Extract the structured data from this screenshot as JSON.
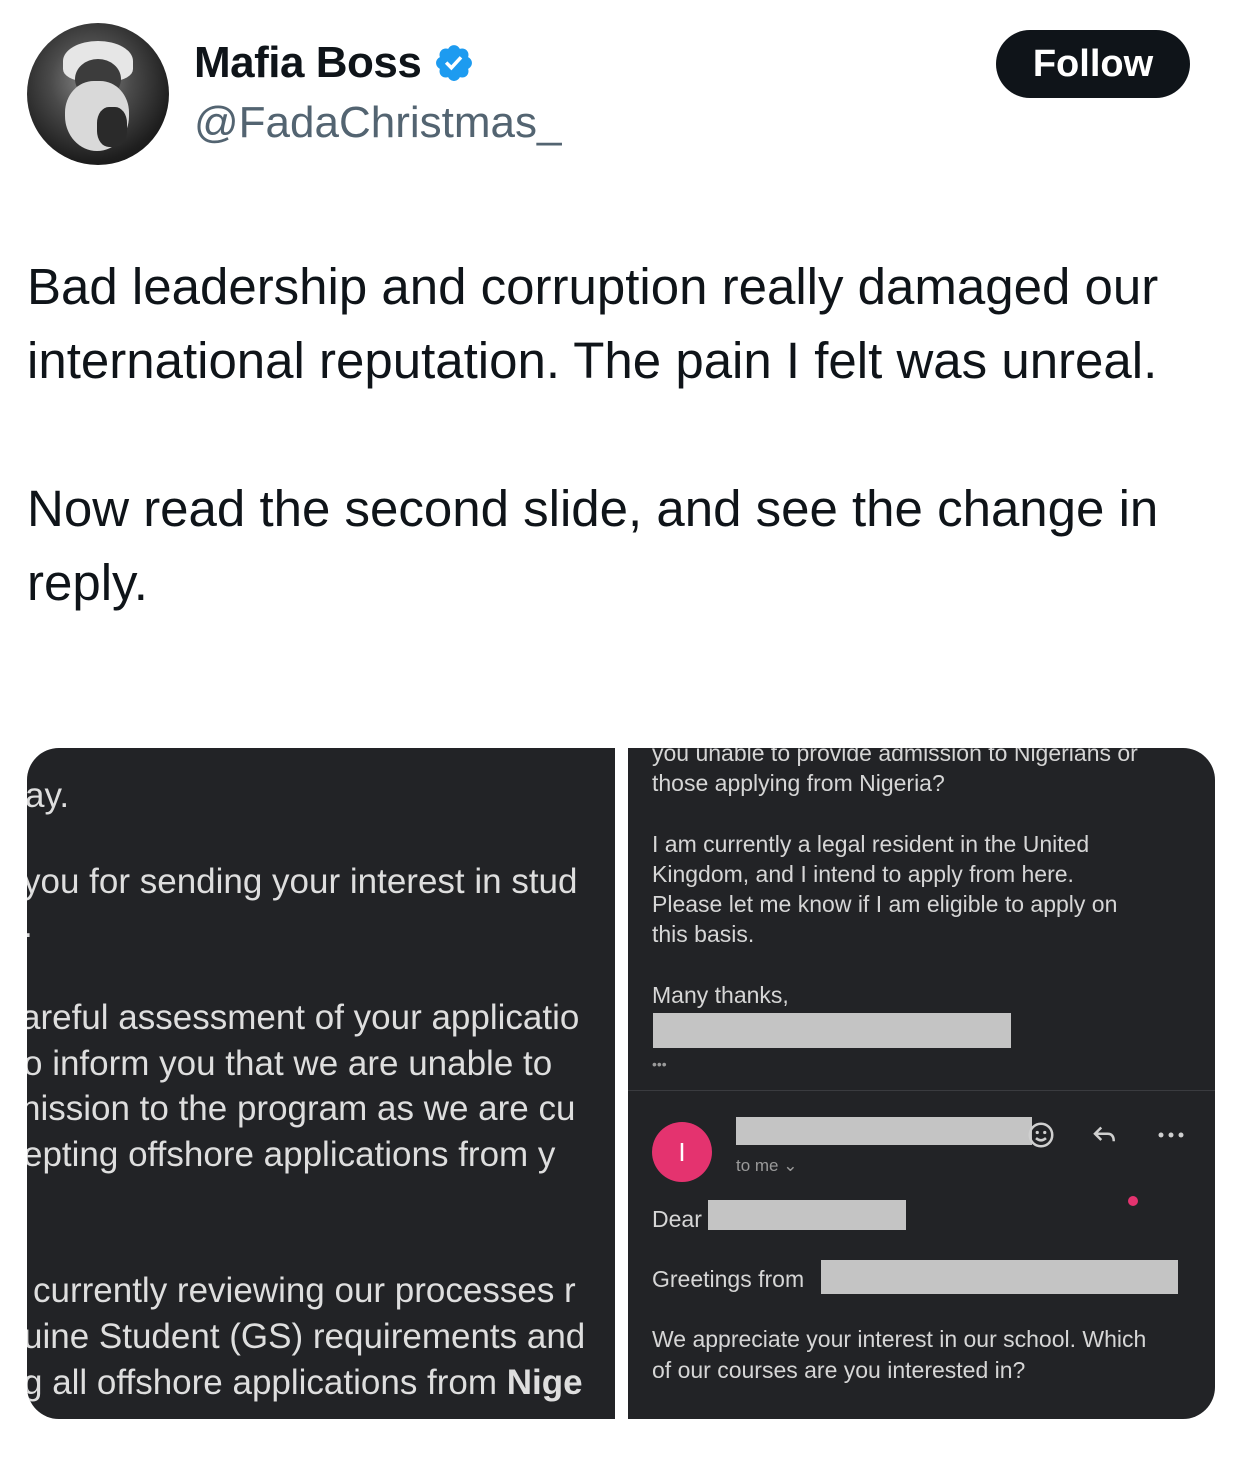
{
  "author": {
    "display_name": "Mafia Boss",
    "handle": "@FadaChristmas_",
    "verified_icon": "verified-badge-icon",
    "verified_color": "#1d9bf0"
  },
  "follow_label": "Follow",
  "tweet": {
    "paragraph1": "Bad leadership and corruption really damaged our international reputation. The pain I felt was unreal.",
    "paragraph2": "Now read the second slide, and see the change in reply."
  },
  "slide1": {
    "line1": "ay.",
    "line2": "you for sending your interest in stud",
    "line3": ".",
    "line4": "areful assessment of your applicatio",
    "line5": "o inform you that we are unable to",
    "line6": "nission to the program as we are cu",
    "line7": "epting offshore applications from y",
    "line8": "currently reviewing our processes r",
    "line9": "uine Student (GS) requirements and",
    "line10a": "g all offshore applications from ",
    "line10b": "Nige"
  },
  "slide2": {
    "top_cut": "you unable to provide admission to Nigerians or",
    "line1": "those applying from Nigeria?",
    "para_line1": "I am currently a legal resident in the United",
    "para_line2": "Kingdom, and I intend to apply from here.",
    "para_line3": "Please let me know if I am eligible to apply on",
    "para_line4": "this basis.",
    "thanks": "Many thanks,",
    "ellipsis": "•••",
    "sender_initial": "I",
    "to_me": "to me ⌄",
    "dear": "Dear",
    "greetings": "Greetings from",
    "reply_line1": "We appreciate your interest in our school. Which",
    "reply_line2": "of our courses are you interested in?"
  }
}
